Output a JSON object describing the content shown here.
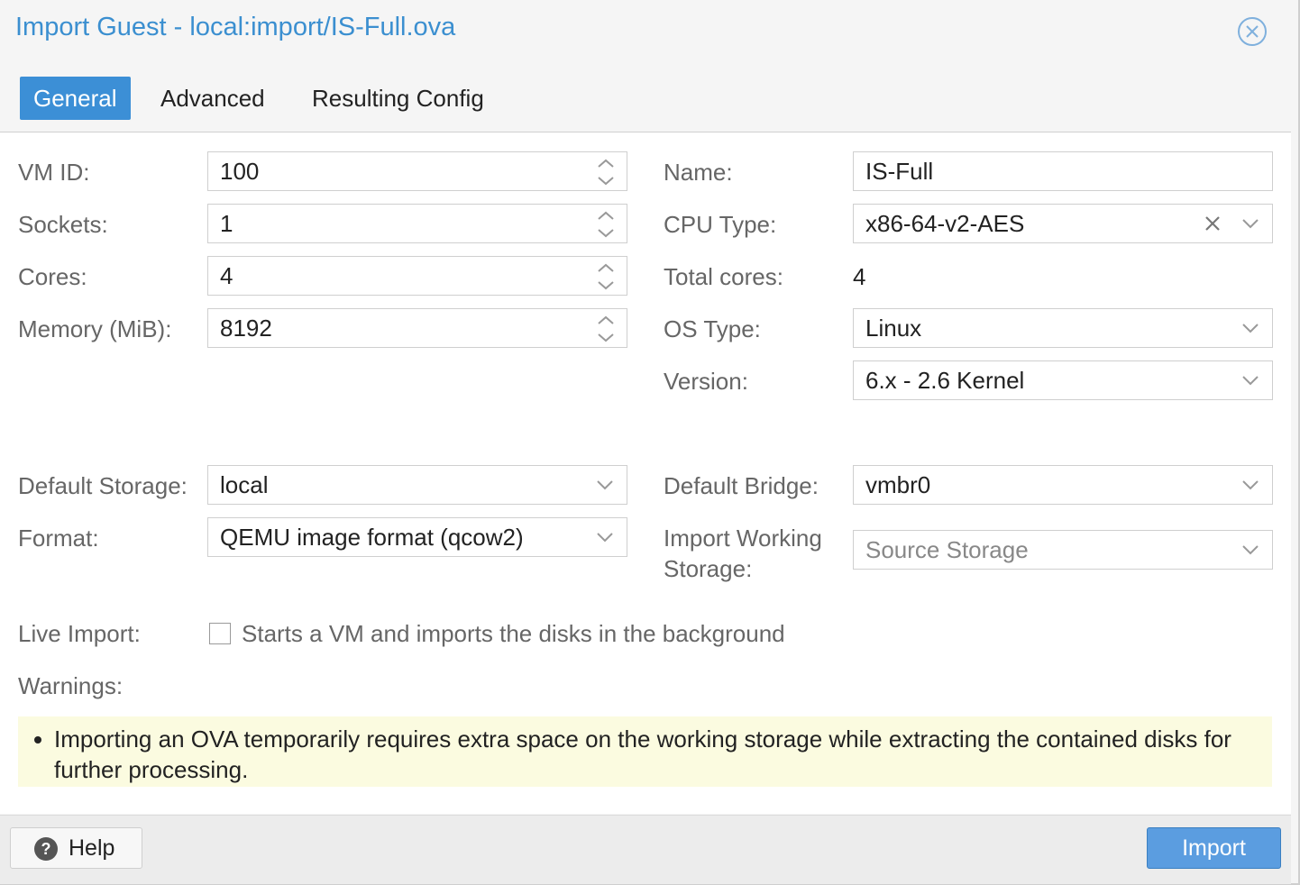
{
  "dialog": {
    "title": "Import Guest - local:import/IS-Full.ova",
    "close_icon": "close-circle-icon"
  },
  "tabs": [
    {
      "label": "General",
      "active": true
    },
    {
      "label": "Advanced",
      "active": false
    },
    {
      "label": "Resulting Config",
      "active": false
    }
  ],
  "general": {
    "vm_id": {
      "label": "VM ID:",
      "value": "100"
    },
    "sockets": {
      "label": "Sockets:",
      "value": "1"
    },
    "cores": {
      "label": "Cores:",
      "value": "4"
    },
    "memory": {
      "label": "Memory (MiB):",
      "value": "8192"
    },
    "name": {
      "label": "Name:",
      "value": "IS-Full"
    },
    "cpu_type": {
      "label": "CPU Type:",
      "value": "x86-64-v2-AES"
    },
    "total_cores": {
      "label": "Total cores:",
      "value": "4"
    },
    "os_type": {
      "label": "OS Type:",
      "value": "Linux"
    },
    "version": {
      "label": "Version:",
      "value": "6.x - 2.6 Kernel"
    },
    "default_storage": {
      "label": "Default Storage:",
      "value": "local"
    },
    "format": {
      "label": "Format:",
      "value": "QEMU image format (qcow2)"
    },
    "default_bridge": {
      "label": "Default Bridge:",
      "value": "vmbr0"
    },
    "import_working_storage": {
      "label_line1": "Import Working",
      "label_line2": "Storage:",
      "placeholder": "Source Storage"
    },
    "live_import": {
      "label": "Live Import:",
      "checked": false,
      "box_label": "Starts a VM and imports the disks in the background"
    },
    "warnings": {
      "label": "Warnings:",
      "items": [
        "Importing an OVA temporarily requires extra space on the working storage while extracting the contained disks for further processing."
      ]
    }
  },
  "footer": {
    "help_label": "Help",
    "help_icon": "question-circle-icon",
    "import_label": "Import"
  },
  "colors": {
    "accent": "#3c8fd6",
    "title": "#3b8fd0",
    "warning_bg": "#fbfbe0"
  }
}
